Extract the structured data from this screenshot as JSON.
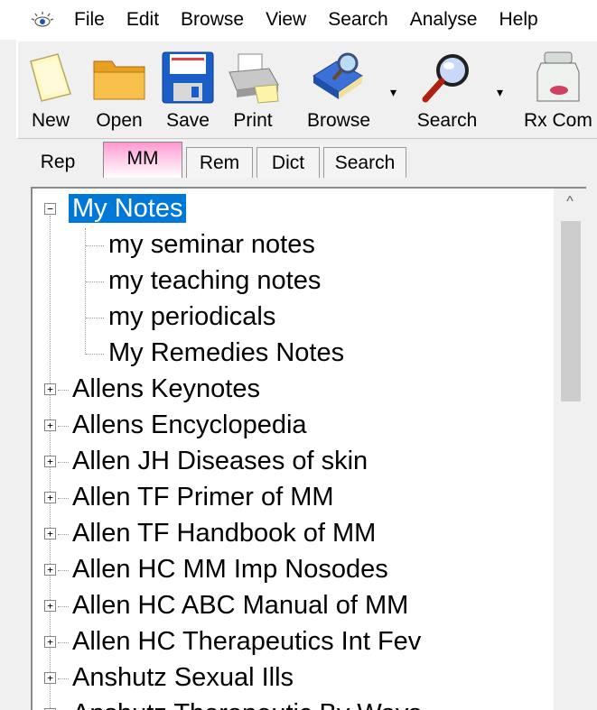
{
  "menubar": {
    "app_icon": "eye-icon",
    "items": [
      "File",
      "Edit",
      "Browse",
      "View",
      "Search",
      "Analyse",
      "Help"
    ]
  },
  "toolbar": {
    "buttons": [
      {
        "label": "New",
        "icon": "new-document-icon"
      },
      {
        "label": "Open",
        "icon": "folder-icon"
      },
      {
        "label": "Save",
        "icon": "floppy-disk-icon"
      },
      {
        "label": "Print",
        "icon": "printer-icon"
      },
      {
        "label": "Browse",
        "icon": "book-magnifier-icon"
      },
      {
        "label": "Search",
        "icon": "magnifier-icon"
      },
      {
        "label": "Rx Com",
        "icon": "medicine-jar-icon"
      }
    ]
  },
  "tabs": [
    "Rep",
    "MM",
    "Rem",
    "Dict",
    "Search"
  ],
  "active_tab": "MM",
  "tree": {
    "root": "My Notes",
    "children": [
      "my seminar notes",
      "my teaching notes",
      "my periodicals",
      "My Remedies Notes"
    ],
    "books": [
      "Allens Keynotes",
      "Allens Encyclopedia",
      "Allen JH Diseases of skin",
      "Allen TF Primer of MM",
      "Allen TF Handbook of MM",
      "Allen HC MM Imp Nosodes",
      "Allen HC ABC Manual of MM",
      "Allen HC Therapeutics Int Fev",
      "Anshutz Sexual Ills",
      "Anshutz Therapeutic By Ways"
    ],
    "expander_collapsed": "+",
    "expander_expanded": "−"
  },
  "scrollbar": {
    "up_arrow": "^"
  },
  "colors": {
    "selection": "#0078d7",
    "active_tab": "#ff9ad1"
  }
}
